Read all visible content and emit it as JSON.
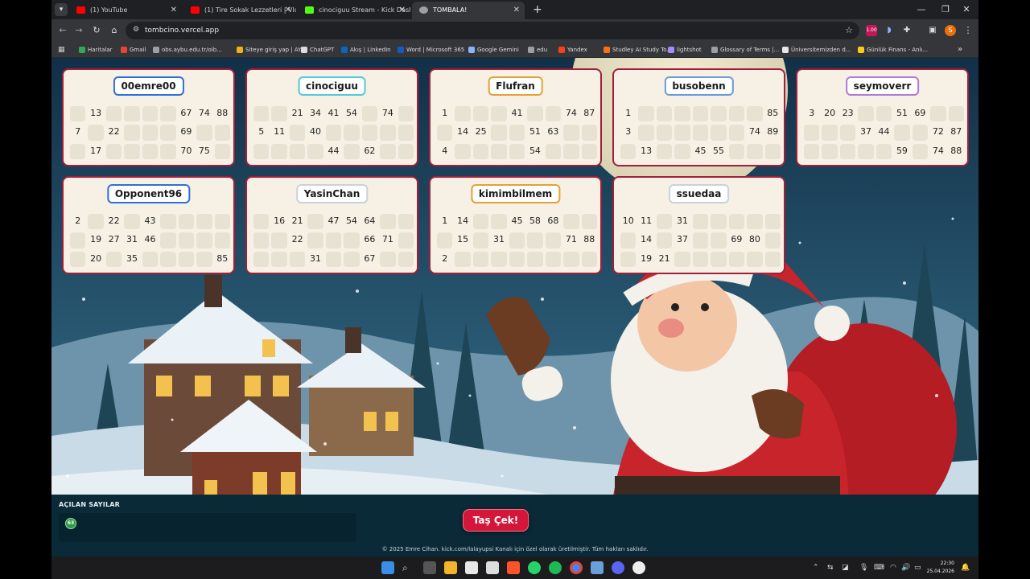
{
  "browser": {
    "tabs": [
      {
        "title": "(1) YouTube",
        "active": false,
        "favicon_color": "#ff0000"
      },
      {
        "title": "(1) Tire Sokak Lezzetleri | Vlog",
        "active": false,
        "favicon_color": "#ff0000"
      },
      {
        "title": "cinociguu Stream - Kick Dashbo",
        "active": false,
        "favicon_color": "#53fc18"
      },
      {
        "title": "TOMBALA!",
        "active": true,
        "favicon_color": "#9aa0a6"
      }
    ],
    "url": "tombcino.vercel.app",
    "bookmarks": [
      {
        "label": "Haritalar",
        "color": "#34a853"
      },
      {
        "label": "Gmail",
        "color": "#ea4335"
      },
      {
        "label": "obs.aybu.edu.tr/oib...",
        "color": "#9aa0a6"
      },
      {
        "label": "Siteye giriş yap | AY...",
        "color": "#f2b01e"
      },
      {
        "label": "ChatGPT",
        "color": "#dddddd"
      },
      {
        "label": "Akış | LinkedIn",
        "color": "#0a66c2"
      },
      {
        "label": "Word | Microsoft 365",
        "color": "#185abd"
      },
      {
        "label": "Google Gemini",
        "color": "#8ab4f8"
      },
      {
        "label": "edu",
        "color": "#9aa0a6"
      },
      {
        "label": "Yandex",
        "color": "#fc3f1d"
      },
      {
        "label": "Studley AI Study To...",
        "color": "#f97316"
      },
      {
        "label": "lightshot",
        "color": "#a78bfa"
      },
      {
        "label": "Glossary of Terms |...",
        "color": "#9aa0a6"
      },
      {
        "label": "Üniversitemizden d...",
        "color": "#e5e7eb"
      },
      {
        "label": "Günlük Finans - Anlı...",
        "color": "#facc15"
      }
    ],
    "ext_badge": "1.00",
    "profile_letter": "S"
  },
  "players": [
    {
      "name": "00emre00",
      "border_color": "#2f6fd6",
      "rows": [
        [
          null,
          13,
          null,
          null,
          null,
          null,
          67,
          74,
          88
        ],
        [
          7,
          null,
          22,
          null,
          null,
          null,
          69,
          null,
          null
        ],
        [
          null,
          17,
          null,
          null,
          null,
          null,
          70,
          75,
          null
        ]
      ]
    },
    {
      "name": "cinociguu",
      "border_color": "#52c9d6",
      "rows": [
        [
          null,
          null,
          21,
          34,
          41,
          54,
          null,
          74,
          null
        ],
        [
          5,
          11,
          null,
          40,
          null,
          null,
          null,
          null,
          null
        ],
        [
          null,
          null,
          null,
          null,
          44,
          null,
          62,
          null,
          null
        ]
      ]
    },
    {
      "name": "Flufran",
      "border_color": "#e6a034",
      "rows": [
        [
          1,
          null,
          null,
          null,
          41,
          null,
          null,
          74,
          87
        ],
        [
          null,
          14,
          25,
          null,
          null,
          51,
          63,
          null,
          null
        ],
        [
          4,
          null,
          null,
          null,
          null,
          54,
          null,
          null,
          null
        ]
      ]
    },
    {
      "name": "busobenn",
      "border_color": "#6c9ad9",
      "rows": [
        [
          1,
          null,
          null,
          null,
          null,
          null,
          null,
          null,
          85
        ],
        [
          3,
          null,
          null,
          null,
          null,
          null,
          null,
          74,
          89
        ],
        [
          null,
          13,
          null,
          null,
          45,
          55,
          null,
          null,
          null
        ]
      ]
    },
    {
      "name": "seymoverr",
      "border_color": "#b07ad6",
      "rows": [
        [
          3,
          20,
          23,
          null,
          null,
          51,
          69,
          null,
          null
        ],
        [
          null,
          null,
          null,
          37,
          44,
          null,
          null,
          72,
          87
        ],
        [
          null,
          null,
          null,
          null,
          null,
          59,
          null,
          74,
          88
        ]
      ]
    },
    {
      "name": "Opponent96",
      "border_color": "#2f6fd6",
      "rows": [
        [
          2,
          null,
          22,
          null,
          43,
          null,
          null,
          null,
          null
        ],
        [
          null,
          19,
          27,
          31,
          46,
          null,
          null,
          null,
          null
        ],
        [
          null,
          20,
          null,
          35,
          null,
          null,
          null,
          null,
          85
        ]
      ]
    },
    {
      "name": "YasinChan",
      "border_color": "#c8d2dc",
      "rows": [
        [
          null,
          16,
          21,
          null,
          47,
          54,
          64,
          null,
          null
        ],
        [
          null,
          null,
          22,
          null,
          null,
          null,
          66,
          71,
          null
        ],
        [
          null,
          null,
          null,
          31,
          null,
          null,
          67,
          null,
          null
        ]
      ]
    },
    {
      "name": "kimimbilmem",
      "border_color": "#e6a034",
      "rows": [
        [
          1,
          14,
          null,
          null,
          45,
          58,
          68,
          null,
          null
        ],
        [
          null,
          15,
          null,
          31,
          null,
          null,
          null,
          71,
          88
        ],
        [
          2,
          null,
          null,
          null,
          null,
          null,
          null,
          null,
          null
        ]
      ]
    },
    {
      "name": "ssuedaa",
      "border_color": "#c8d2dc",
      "rows": [
        [
          10,
          11,
          null,
          31,
          null,
          null,
          null,
          null,
          null
        ],
        [
          null,
          14,
          null,
          37,
          null,
          null,
          69,
          80,
          null
        ],
        [
          null,
          19,
          21,
          null,
          null,
          null,
          null,
          null,
          null
        ]
      ]
    }
  ],
  "drawn": {
    "title": "AÇILAN SAYILAR",
    "numbers": [
      "63"
    ]
  },
  "draw_button_label": "Taş Çek!",
  "footer_text": "© 2025 Emre Cihan. kick.com/lalayupsi Kanalı için özel olarak üretilmiştir. Tüm hakları saklıdır.",
  "system": {
    "time": "22:30",
    "date": "25.04.2026"
  }
}
